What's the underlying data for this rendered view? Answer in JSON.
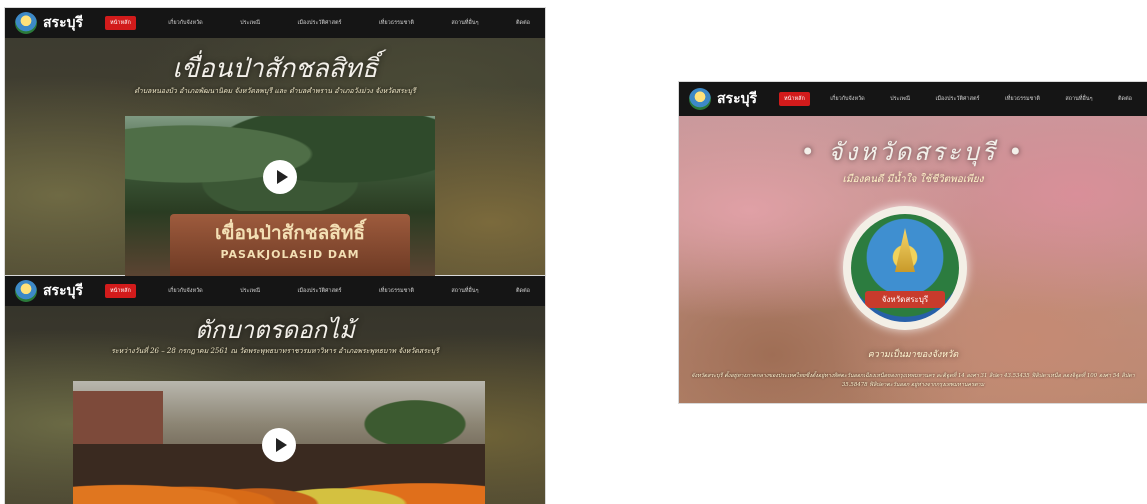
{
  "nav": {
    "logo_text": "สระบุรี",
    "items": [
      "หน้าหลัก",
      "เกี่ยวกับจังหวัด",
      "ประเพณี",
      "เมืองประวัติศาสตร์",
      "เที่ยวธรรมชาติ",
      "สถานที่อื่นๆ",
      "ติดต่อ"
    ]
  },
  "dam_page": {
    "title": "เขื่อนป่าสักชลสิทธิ์",
    "subtitle": "ตำบลหนองบัว อำเภอพัฒนานิคม จังหวัดลพบุรี และ ตำบลคำพราน อำเภอวังม่วง จังหวัดสระบุรี",
    "sign_thai": "เขื่อนป่าสักชลสิทธิ์",
    "sign_en": "PASAKJOLASID DAM"
  },
  "flower_page": {
    "title": "ตักบาตรดอกไม้",
    "subtitle": "ระหว่างวันที่ 26 – 28 กรกฎาคม 2561 ณ วัดพระพุทธบาทราชวรมหาวิหาร อำเภอพระพุทธบาท จังหวัดสระบุรี"
  },
  "home_page": {
    "title": "• จังหวัดสระบุรี •",
    "tagline": "เมืองคนดี มีน้ำใจ ใช้ชีวิตพอเพียง",
    "seal_text": "จังหวัดสระบุรี",
    "heading": "ความเป็นมาของจังหวัด",
    "body": "จังหวัดสระบุรี ตั้งอยู่ทางภาคกลางของประเทศไทยซึ่งตั้งอยู่ทางทิศตะวันออกเฉียงเหนือของกรุงเทพมหานคร ละติจูดที่ 14 องศา 31 ลิปดา 43.53435 ฟิลิปดาเหนือ ลองจิจูดที่ 100 องศา 54 ลิปดา 35.58478 ฟิลิปดาตะวันออก อยู่ห่างจากกรุงเทพมหานครตาม"
  }
}
